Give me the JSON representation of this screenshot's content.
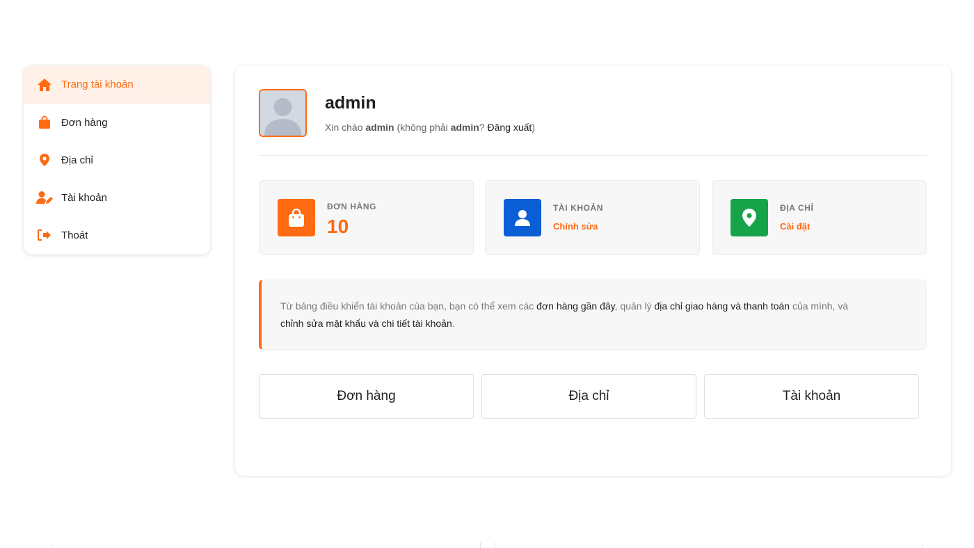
{
  "sidebar": {
    "items": [
      {
        "label": "Trang tài khoản",
        "icon": "home-icon",
        "active": true
      },
      {
        "label": "Đơn hàng",
        "icon": "shopping-bag-icon"
      },
      {
        "label": "Địa chỉ",
        "icon": "map-pin-icon"
      },
      {
        "label": "Tài khoản",
        "icon": "user-edit-icon"
      },
      {
        "label": "Thoát",
        "icon": "logout-icon"
      }
    ]
  },
  "profile": {
    "username": "admin",
    "greeting_prefix": "Xin chào ",
    "greeting_user": "admin",
    "greeting_middle": " (không phải ",
    "greeting_user2": "admin",
    "greeting_q": "? ",
    "logout_label": "Đăng xuất",
    "greeting_end": ")"
  },
  "stats": [
    {
      "label": "ĐƠN HÀNG",
      "value": "10",
      "icon": "shopping-bag-icon",
      "color": "#ff6a13"
    },
    {
      "label": "TÀI KHOẢN",
      "link": "Chỉnh sửa",
      "icon": "user-icon",
      "color": "#0b5fd6"
    },
    {
      "label": "ĐỊA CHỈ",
      "link": "Cài đặt",
      "icon": "map-pin-icon",
      "color": "#16a34a"
    }
  ],
  "notice": {
    "t1": "Từ bảng điều khiển tài khoản của bạn, bạn có thể xem các ",
    "l1": "đơn hàng gần đây",
    "t2": ", quản lý ",
    "l2": "địa chỉ giao hàng và thanh toán",
    "t3": " của mình, và ",
    "l3": "chỉnh sửa mật khẩu và chi tiết tài khoản",
    "t4": "."
  },
  "buttons": [
    {
      "label": "Đơn hàng"
    },
    {
      "label": "Địa chỉ"
    },
    {
      "label": "Tài khoản"
    }
  ],
  "colors": {
    "accent": "#ff6a13",
    "blue": "#0b5fd6",
    "green": "#16a34a"
  }
}
